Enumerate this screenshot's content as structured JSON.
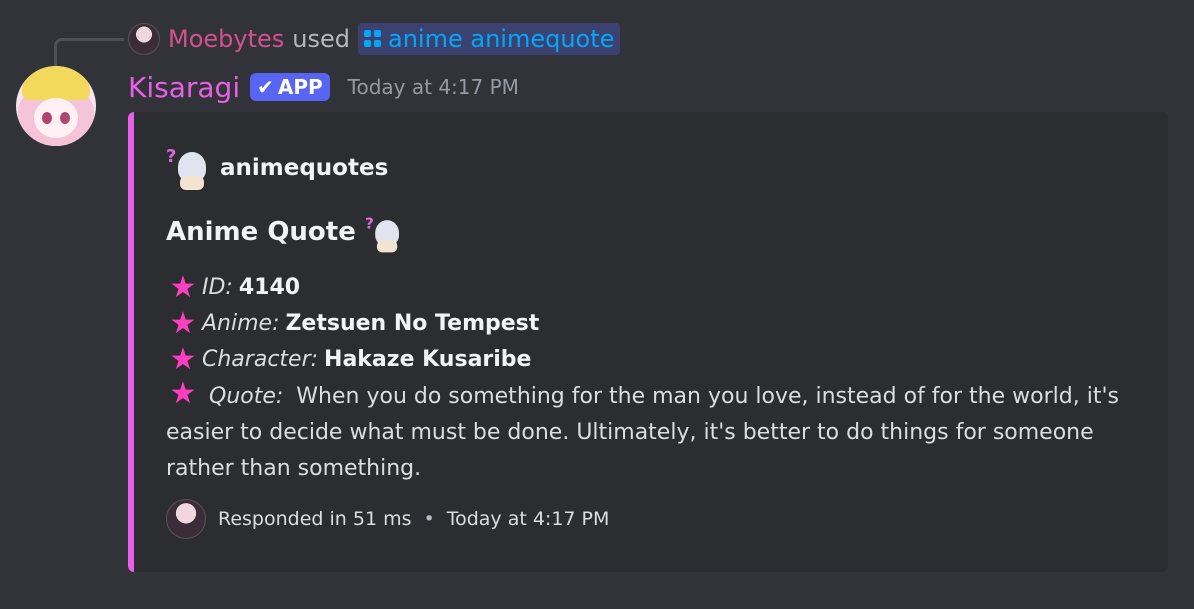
{
  "reply": {
    "user": "Moebytes",
    "used_text": "used",
    "command": "anime animequote"
  },
  "message": {
    "author": "Kisaragi",
    "badge": "APP",
    "timestamp": "Today at 4:17 PM"
  },
  "embed": {
    "accent_color": "#e860e8",
    "author_name": "animequotes",
    "title": "Anime Quote",
    "fields": [
      {
        "label": "ID:",
        "value": "4140"
      },
      {
        "label": "Anime:",
        "value": "Zetsuen No Tempest"
      },
      {
        "label": "Character:",
        "value": "Hakaze Kusaribe"
      },
      {
        "label": "Quote:",
        "value": "When you do something for the man you love, instead of for the world, it's easier to decide what must be done. Ultimately, it's better to do things for someone rather than something."
      }
    ],
    "footer": {
      "response": "Responded in 51 ms",
      "separator": "•",
      "time": "Today at 4:17 PM"
    }
  },
  "icons": {
    "star": "★",
    "check": "✔"
  }
}
